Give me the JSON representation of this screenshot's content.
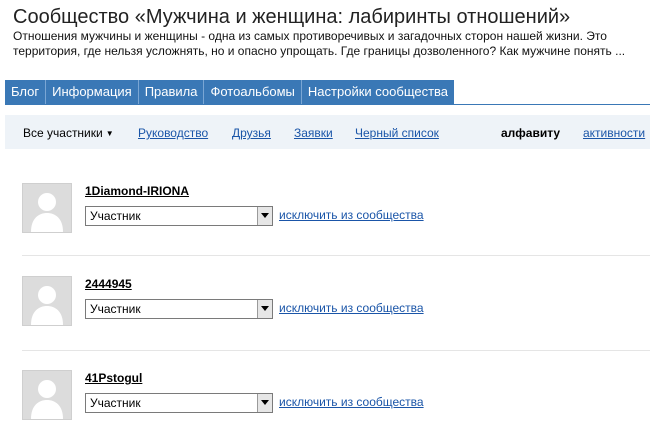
{
  "community": {
    "title": "Сообщество «Мужчина и женщина: лабиринты отношений»",
    "description": "Отношения мужчины и женщины - одна из самых противоречивых и загадочных сторон нашей жизни. Это территория, где нельзя усложнять, но и опасно упрощать. Где границы дозволенного? Как мужчине понять ..."
  },
  "tabs": [
    "Блог",
    "Информация",
    "Правила",
    "Фотоальбомы",
    "Настройки сообщества"
  ],
  "subnav": {
    "dropdown_label": "Все участники",
    "links": [
      "Руководство",
      "Друзья",
      "Заявки",
      "Черный список"
    ],
    "sort_active": "алфавиту",
    "sort_other": "активности"
  },
  "members": [
    {
      "name": "1Diamond-IRIONA",
      "role": "Участник",
      "exclude_label": "исключить из сообщества"
    },
    {
      "name": "2444945",
      "role": "Участник",
      "exclude_label": "исключить из сообщества"
    },
    {
      "name": "41Pstogul",
      "role": "Участник",
      "exclude_label": "исключить из сообщества"
    }
  ],
  "colors": {
    "tab_bar": "#3a78b6",
    "subnav_bg": "#eef3f8",
    "link": "#1a55a8"
  },
  "icons": {
    "avatar": "default-user-silhouette-icon",
    "dropdown": "triangle-down-icon"
  }
}
